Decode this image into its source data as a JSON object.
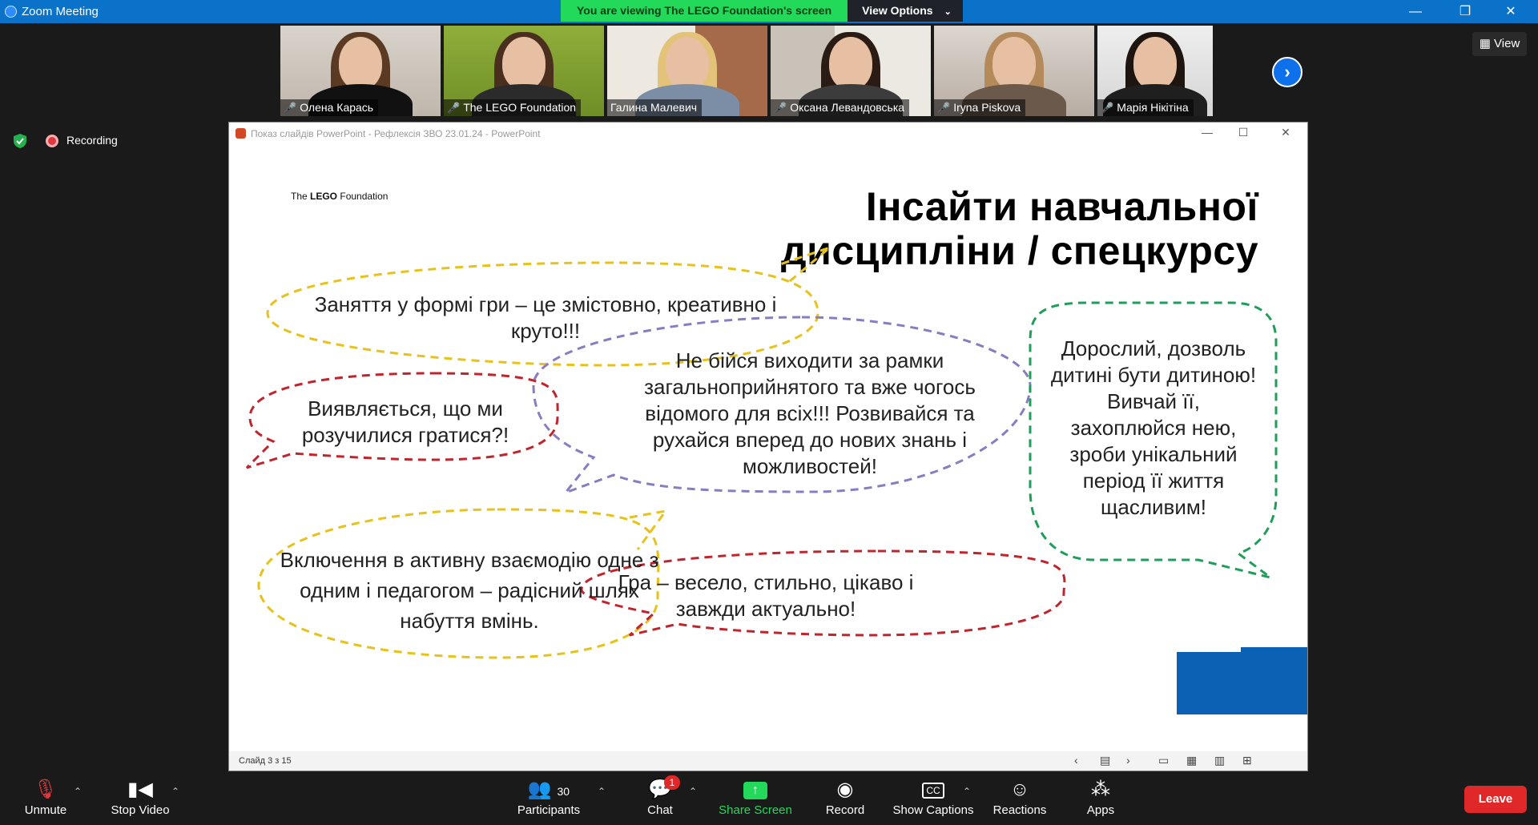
{
  "window": {
    "title": "Zoom Meeting",
    "minimize": "—",
    "restore": "❐",
    "close": "✕"
  },
  "share_banner": {
    "viewing_text": "You are viewing The LEGO Foundation's screen",
    "view_options": "View Options"
  },
  "participants_strip": [
    {
      "name": "Олена Карась"
    },
    {
      "name": "The LEGO Foundation"
    },
    {
      "name": "Галина Малевич"
    },
    {
      "name": "Оксана Левандовська"
    },
    {
      "name": "Iryna Piskova"
    },
    {
      "name": "Марія Нікітіна"
    }
  ],
  "view_button": "View",
  "recording_label": "Recording",
  "powerpoint": {
    "title": "Показ слайдів PowerPoint  -  Рефлексія ЗВО 23.01.24  -  PowerPoint",
    "status_slide": "Слайд 3 з 15"
  },
  "slide": {
    "logo_prefix": "The ",
    "logo_bold": "LEGO",
    "logo_suffix": " Foundation",
    "title_line1": "Інсайти навчальної",
    "title_line2": "дисципліни / спецкурсу",
    "bubbles": [
      {
        "text": "Заняття у формі гри – це змістовно, креативно і круто!!!",
        "color": "#e6c21a"
      },
      {
        "text": "Виявляється, що ми розучилися гратися?!",
        "color": "#c0242c"
      },
      {
        "text": "Не бійся виходити за рамки загальноприйнятого та вже чогось відомого для всіх!!! Розвивайся та рухайся вперед до нових знань і можливостей!",
        "color": "#8a7cc0"
      },
      {
        "text": "Дорослий, дозволь дитині бути дитиною! Вивчай її, захоплюйся нею, зроби унікальний період її життя щасливим!",
        "color": "#1e9e58"
      },
      {
        "text": "Включення в активну взаємодію одне з одним і педагогом – радісний шлях набуття вмінь.",
        "color": "#e6c21a"
      },
      {
        "text": "Гра – весело, стильно, цікаво і завжди актуально!",
        "color": "#c0242c"
      }
    ]
  },
  "toolbar": {
    "unmute": "Unmute",
    "stop_video": "Stop Video",
    "participants": "Participants",
    "participants_count": "30",
    "chat": "Chat",
    "chat_badge": "1",
    "share_screen": "Share Screen",
    "record": "Record",
    "show_captions": "Show Captions",
    "reactions": "Reactions",
    "apps": "Apps",
    "leave": "Leave"
  },
  "colors": {
    "zoom_blue": "#0b72c9",
    "share_green": "#23d959",
    "leave_red": "#e02828",
    "slide_blue": "#0b62b5"
  }
}
